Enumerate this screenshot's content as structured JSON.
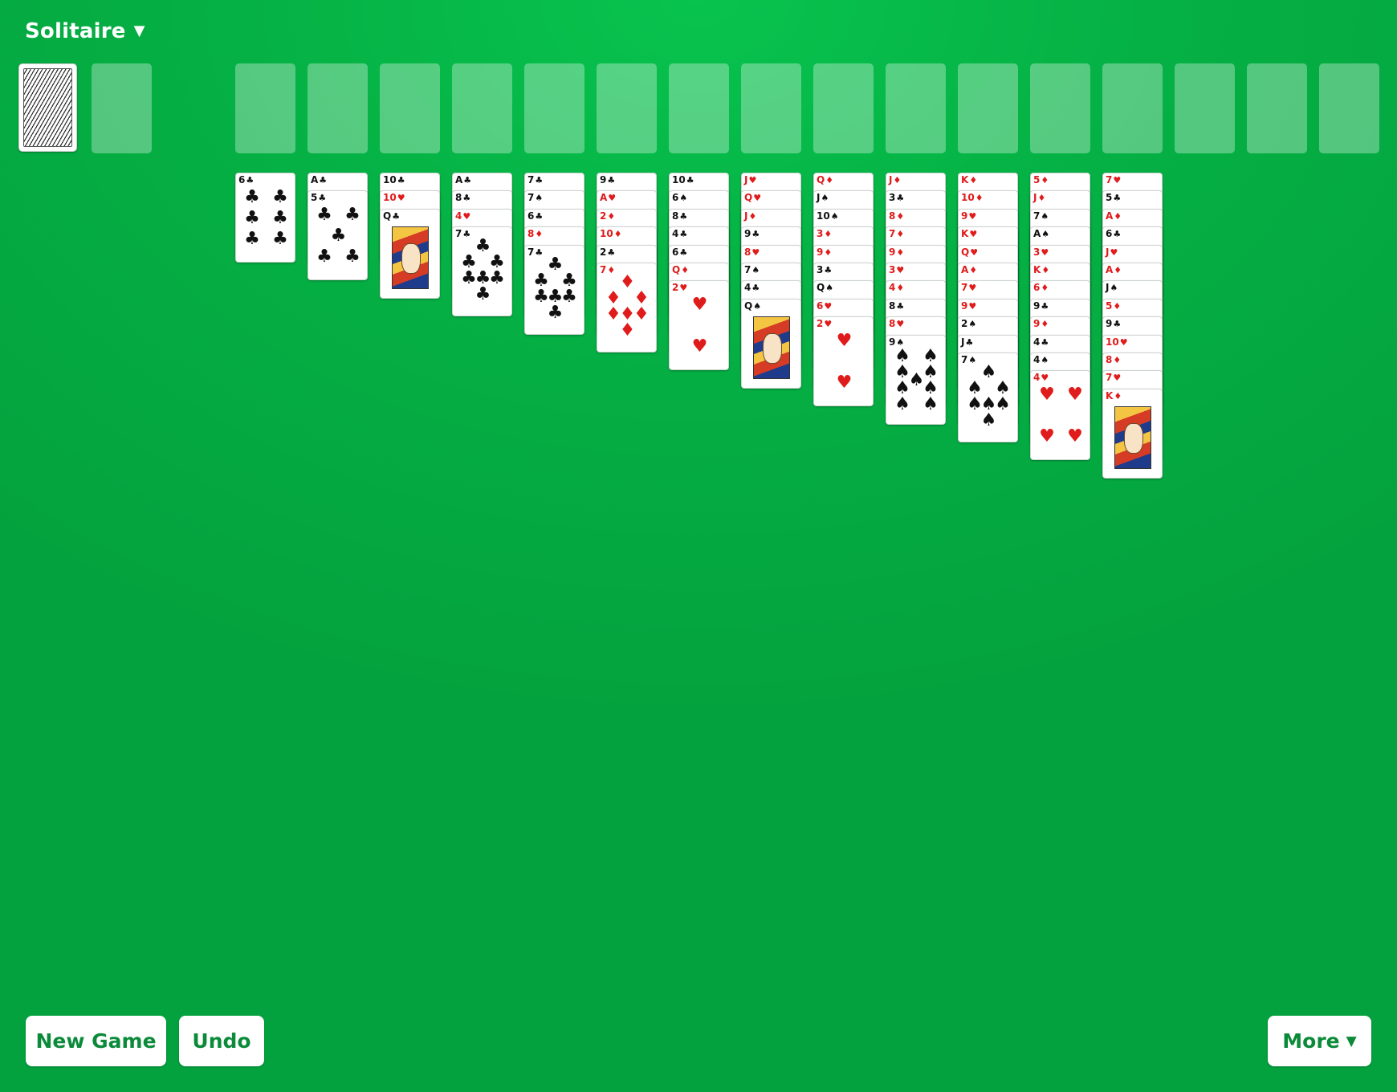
{
  "header": {
    "title": "Solitaire",
    "dropdown_icon": "triangle-down-icon"
  },
  "buttons": {
    "new_game": "New Game",
    "undo": "Undo",
    "more": "More"
  },
  "suits": {
    "S": "♠",
    "H": "♥",
    "D": "♦",
    "C": "♣"
  },
  "tableau": [
    [
      "6C"
    ],
    [
      "AC",
      "5C"
    ],
    [
      "10C",
      "10H",
      "QC"
    ],
    [
      "AC",
      "8C",
      "4H",
      "7C"
    ],
    [
      "7C",
      "7S",
      "6C",
      "8D",
      "7C"
    ],
    [
      "9C",
      "AH",
      "2D",
      "10D",
      "2C",
      "7D"
    ],
    [
      "10C",
      "6S",
      "8C",
      "4C",
      "6C",
      "QD",
      "2H"
    ],
    [
      "JH",
      "QH",
      "JD",
      "9C",
      "8H",
      "7S",
      "4C",
      "QS"
    ],
    [
      "QD",
      "JS",
      "10S",
      "3D",
      "9D",
      "3C",
      "QS",
      "6H",
      "2H"
    ],
    [
      "JD",
      "3C",
      "8D",
      "7D",
      "9D",
      "3H",
      "4D",
      "8C",
      "8H",
      "9S"
    ],
    [
      "KD",
      "10D",
      "9H",
      "KH",
      "QH",
      "AD",
      "7H",
      "9H",
      "2S",
      "JC",
      "7S"
    ],
    [
      "5D",
      "JD",
      "7S",
      "AS",
      "3H",
      "KD",
      "6D",
      "9C",
      "9D",
      "4C",
      "4S",
      "4H"
    ],
    [
      "7H",
      "5C",
      "AD",
      "6C",
      "JH",
      "AD",
      "JS",
      "5D",
      "9C",
      "10H",
      "8D",
      "7H",
      "KD"
    ]
  ]
}
